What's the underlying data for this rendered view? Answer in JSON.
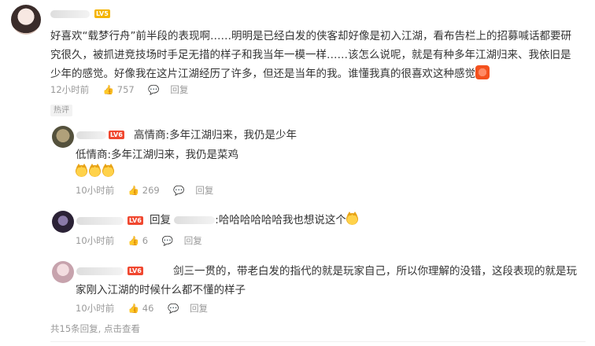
{
  "main": {
    "lv_badge": "LV5",
    "text": "好喜欢“载梦行舟”前半段的表现啊……明明是已经白发的侠客却好像是初入江湖，看布告栏上的招募喊话都要研究很久，被抓进竞技场时手足无措的样子和我当年一模一样……该怎么说呢，就是有种多年江湖归来、我依旧是少年的感觉。好像我在这片江湖经历了许多，但还是当年的我。谁懂我真的很喜欢这种感觉",
    "time": "12小时前",
    "likes": "757",
    "reply_label": "回复"
  },
  "hot_tag": "热评",
  "replies": [
    {
      "lv_badge": "LV6",
      "line1": "高情商:多年江湖归来，我仍是少年",
      "line2": "低情商:多年江湖归来，我仍是菜鸡",
      "time": "10小时前",
      "likes": "269",
      "reply_label": "回复"
    },
    {
      "lv_badge": "LV6",
      "reply_prefix": "回复",
      "text": ":哈哈哈哈哈哈我也想说这个",
      "time": "10小时前",
      "likes": "6",
      "reply_label": "回复"
    },
    {
      "lv_badge": "LV6",
      "text": "剑三一贯的，带老白发的指代的就是玩家自己，所以你理解的没错，这段表现的就是玩家刚入江湖的时候什么都不懂的样子",
      "time": "10小时前",
      "likes": "46",
      "reply_label": "回复"
    }
  ],
  "footer": "共15条回复, 点击查看"
}
